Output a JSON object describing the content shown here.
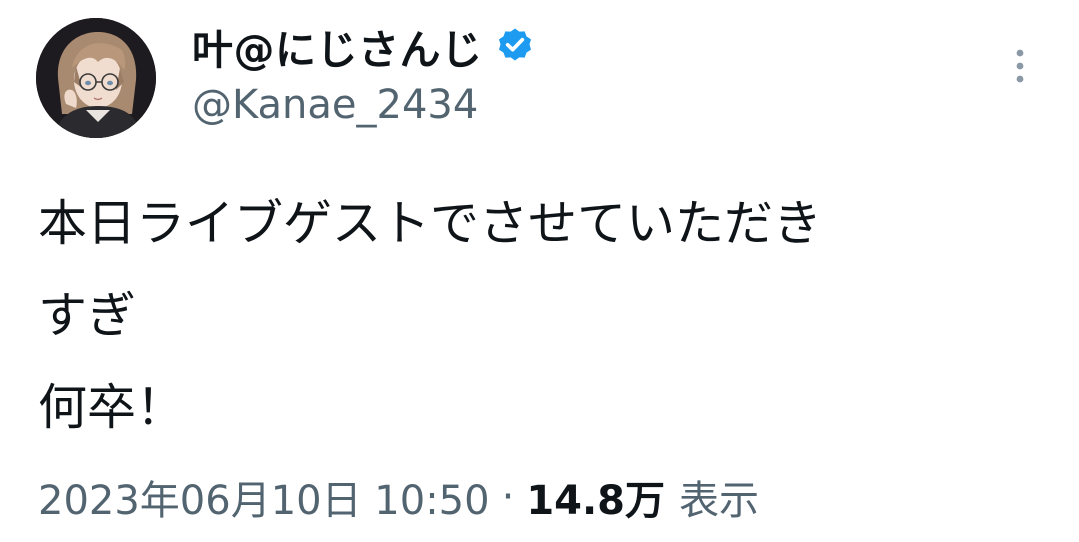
{
  "author": {
    "display_name": "叶@にじさんじ",
    "handle": "@Kanae_2434",
    "verified": true,
    "verified_color": "#1d9bf0"
  },
  "tweet": {
    "lines": [
      "本日ライブゲストでさせていただき",
      "すぎ",
      "何卒！"
    ]
  },
  "meta": {
    "timestamp": "2023年06月10日 10:50",
    "separator": "·",
    "views_count": "14.8万",
    "views_label": "表示"
  },
  "icons": {
    "more": "more-vertical-icon",
    "verified": "verified-badge-icon"
  }
}
